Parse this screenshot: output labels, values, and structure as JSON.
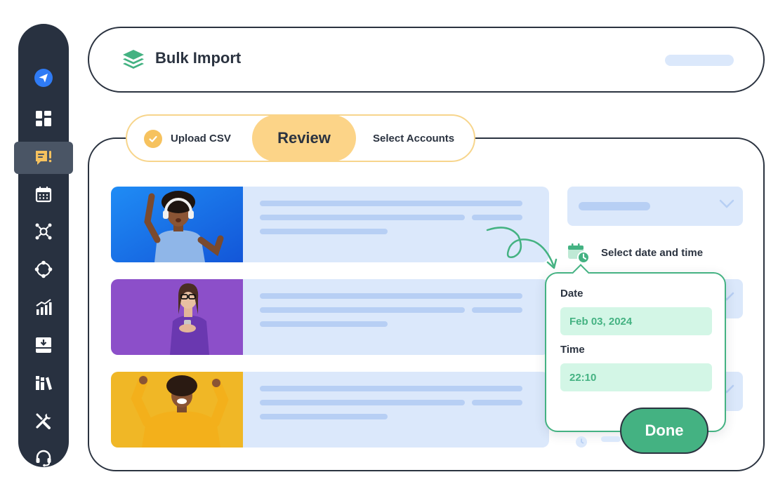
{
  "header": {
    "title": "Bulk Import"
  },
  "stepper": {
    "steps": [
      {
        "label": "Upload CSV",
        "state": "complete"
      },
      {
        "label": "Review",
        "state": "active"
      },
      {
        "label": "Select Accounts",
        "state": "pending"
      }
    ]
  },
  "sidebar": {
    "icons": [
      "send-icon",
      "dashboard-icon",
      "compose-icon",
      "calendar-icon",
      "network-icon",
      "connect-icon",
      "analytics-icon",
      "inbox-icon",
      "library-icon",
      "tools-icon",
      "support-icon"
    ],
    "active_index": 2
  },
  "schedule": {
    "label": "Select date and time",
    "date_label": "Date",
    "date_value": "Feb 03, 2024",
    "time_label": "Time",
    "time_value": "22:10",
    "done_label": "Done"
  },
  "colors": {
    "sidebar_bg": "#283140",
    "accent_yellow": "#f6c25e",
    "accent_green": "#44b282",
    "placeholder_blue": "#dbe8fb"
  }
}
